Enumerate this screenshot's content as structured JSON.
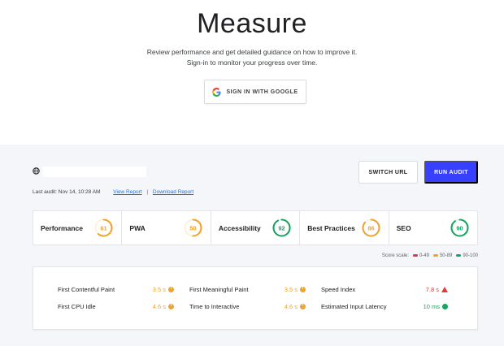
{
  "hero": {
    "title": "Measure",
    "subtitle_line1": "Review performance and get detailed guidance on how to improve it.",
    "subtitle_line2": "Sign-in to monitor your progress over time.",
    "signin_label": "SIGN IN WITH GOOGLE",
    "signin_icon": "google-g-icon"
  },
  "audit": {
    "url_icon": "globe-icon",
    "url_value": "",
    "last_audit": "Last audit: Nov 14, 10:28 AM",
    "view_report": "View Report",
    "separator": "|",
    "download_report": "Download Report",
    "switch_url": "SWITCH URL",
    "run_audit": "RUN AUDIT"
  },
  "colors": {
    "accent": "#3740ff",
    "fail": "#e0393e",
    "average": "#f0a32c",
    "pass": "#1aa260"
  },
  "scores": [
    {
      "label": "Performance",
      "value": "61",
      "status": "average",
      "fraction": 0.61
    },
    {
      "label": "PWA",
      "value": "50",
      "status": "average",
      "fraction": 0.5
    },
    {
      "label": "Accessibility",
      "value": "92",
      "status": "pass",
      "fraction": 0.92
    },
    {
      "label": "Best Practices",
      "value": "86",
      "status": "average",
      "fraction": 0.86
    },
    {
      "label": "SEO",
      "value": "90",
      "status": "pass",
      "fraction": 0.9
    }
  ],
  "scale": {
    "label": "Score scale:",
    "fail": "0-49",
    "average": "50-89",
    "pass": "90-100"
  },
  "metrics": [
    {
      "label": "First Contentful Paint",
      "value": "3.5 s",
      "status": "average"
    },
    {
      "label": "First Meaningful Paint",
      "value": "3.5 s",
      "status": "average"
    },
    {
      "label": "Speed Index",
      "value": "7.8 s",
      "status": "fail"
    },
    {
      "label": "First CPU Idle",
      "value": "4.6 s",
      "status": "average"
    },
    {
      "label": "Time to Interactive",
      "value": "4.6 s",
      "status": "average"
    },
    {
      "label": "Estimated Input Latency",
      "value": "10 ms",
      "status": "pass"
    }
  ]
}
